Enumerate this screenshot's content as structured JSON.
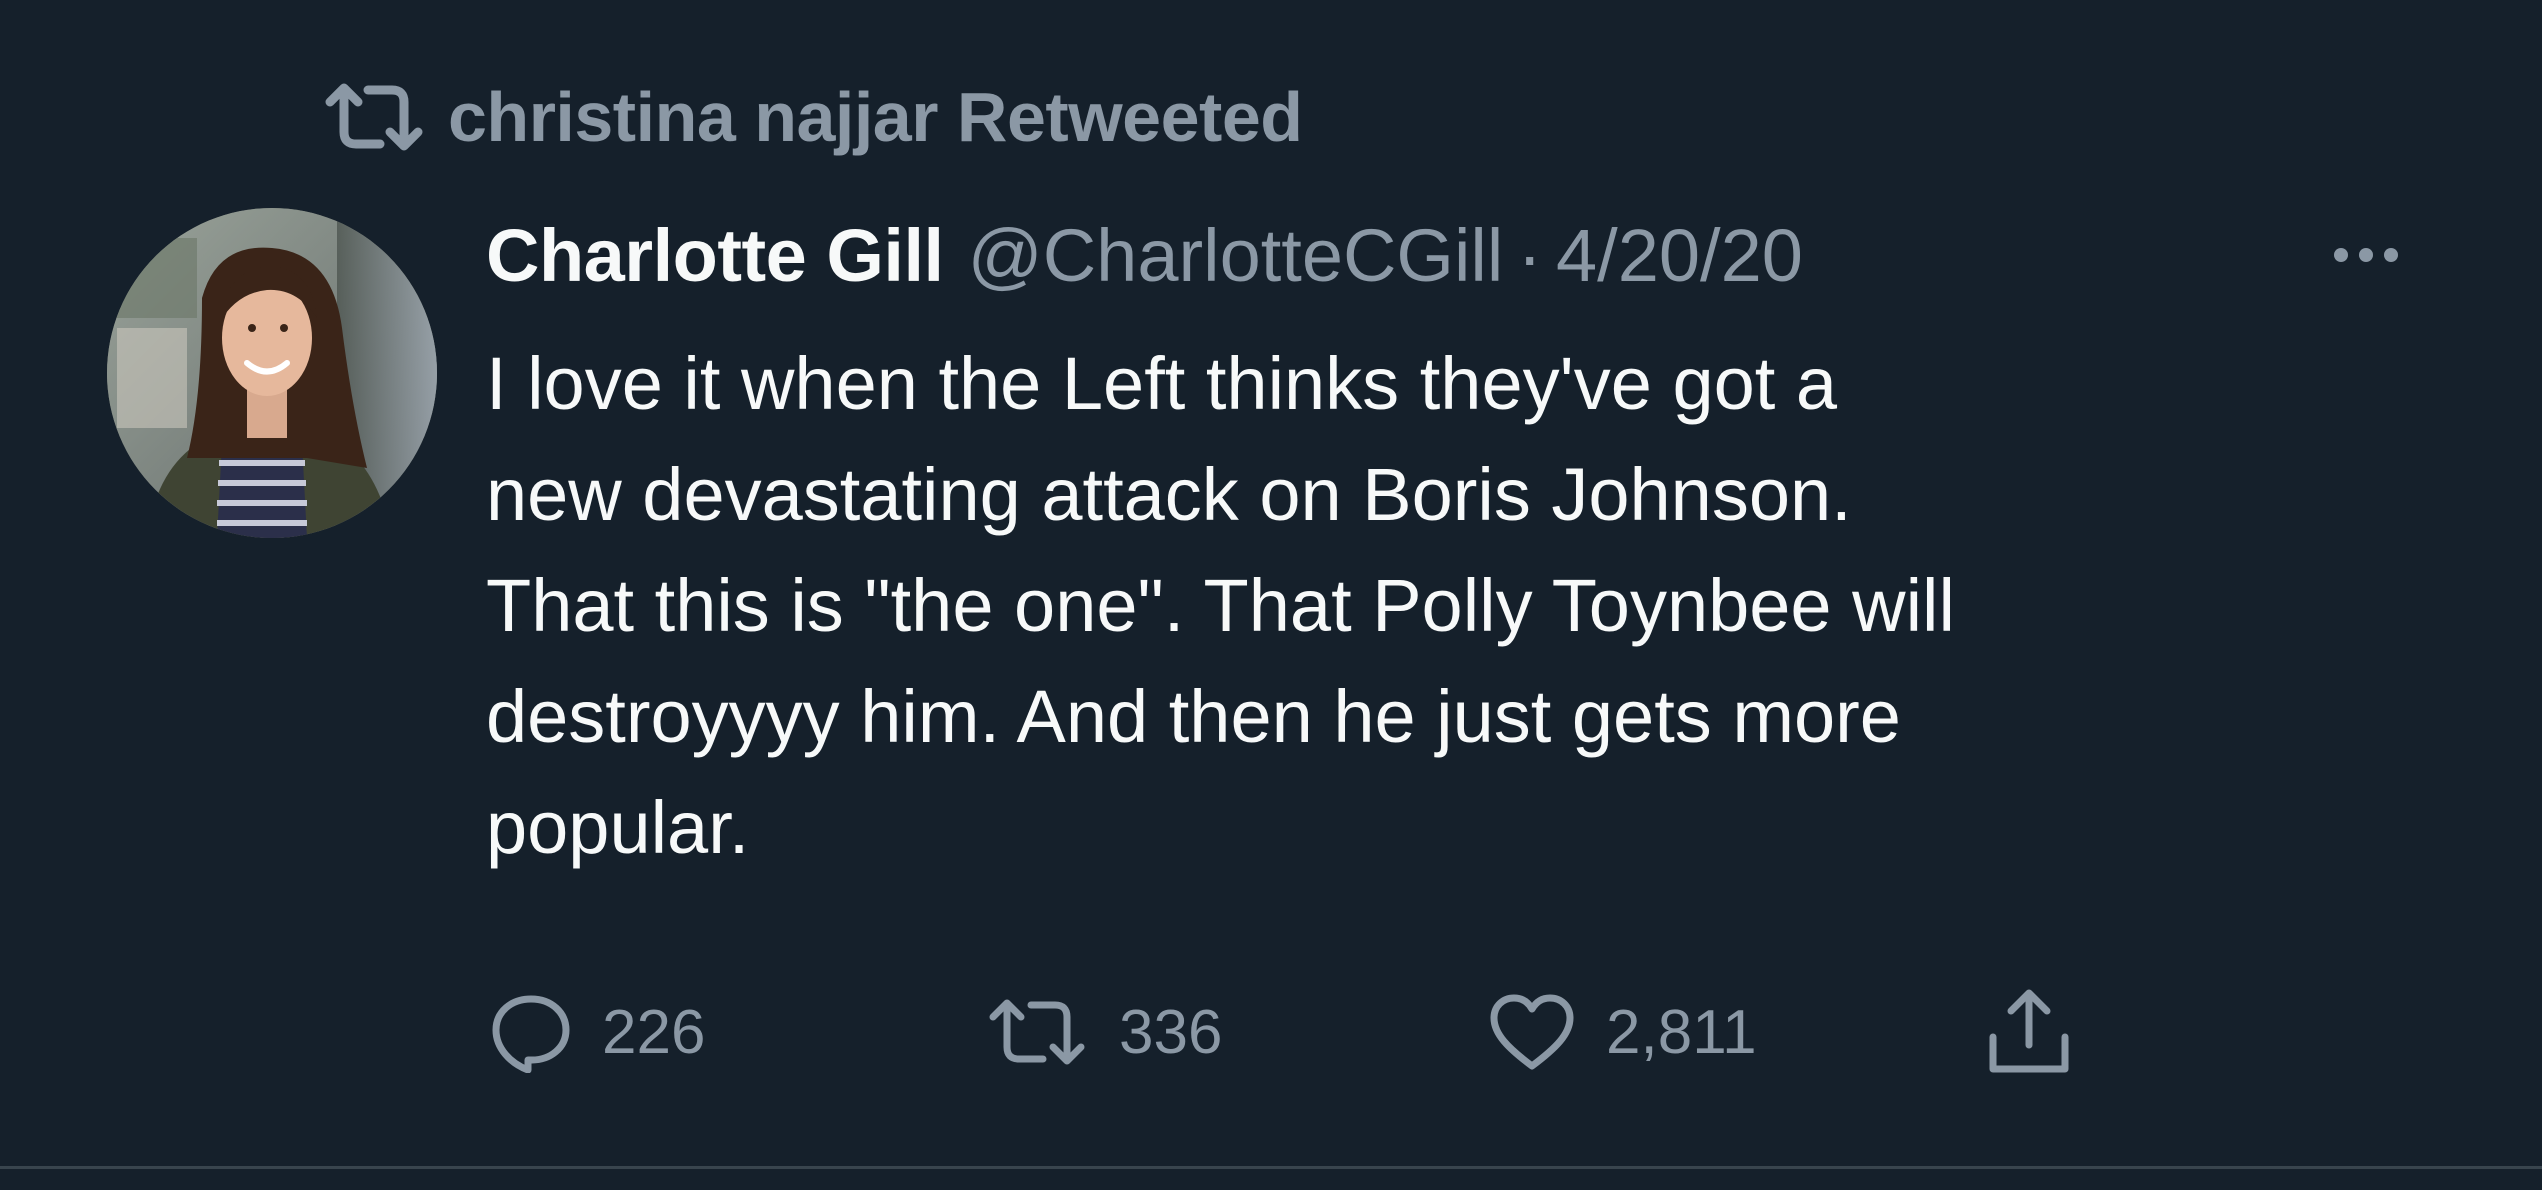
{
  "social_context": {
    "icon": "retweet-icon",
    "label": "christina najjar Retweeted"
  },
  "tweet": {
    "author": {
      "display_name": "Charlotte Gill",
      "handle": "@CharlotteCGill",
      "avatar": "avatar-photo"
    },
    "separator": "·",
    "timestamp": "4/20/20",
    "more_icon": "more-dots-icon",
    "text": "I love it when the Left thinks they've got a\nnew devastating attack on Boris Johnson.\nThat this is \"the one\". That Polly Toynbee will\ndestroyyyy him. And then he just gets more\npopular.",
    "actions": {
      "reply": {
        "icon": "reply-icon",
        "count": "226"
      },
      "retweet": {
        "icon": "retweet-icon",
        "count": "336"
      },
      "like": {
        "icon": "heart-icon",
        "count": "2,811"
      },
      "share": {
        "icon": "share-icon"
      }
    }
  },
  "colors": {
    "background": "#15202b",
    "primary_text": "#f7f9f9",
    "secondary_text": "#8b98a5",
    "divider": "#38444d"
  }
}
